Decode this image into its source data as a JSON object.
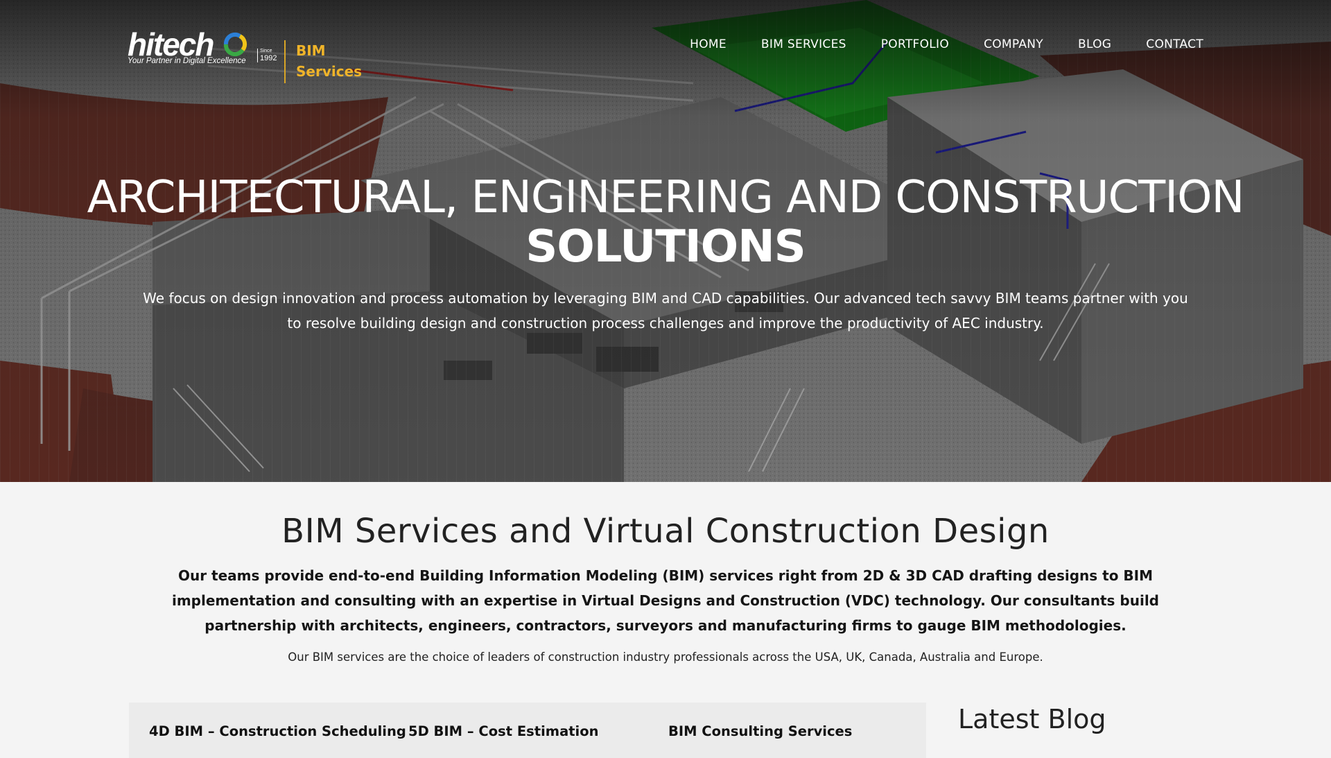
{
  "brand": {
    "logo_word": "hitech",
    "tagline": "Your Partner in Digital Excellence",
    "since_label": "Since",
    "since_year": "1992",
    "site_label": "BIM Services"
  },
  "nav": {
    "items": [
      "HOME",
      "BIM SERVICES",
      "PORTFOLIO",
      "COMPANY",
      "BLOG",
      "CONTACT"
    ]
  },
  "hero": {
    "title_line1": "ARCHITECTURAL, ENGINEERING AND CONSTRUCTION",
    "title_line2": "SOLUTIONS",
    "description": "We focus on design innovation and process automation by leveraging BIM and CAD capabilities. Our advanced tech savvy BIM teams partner with you to resolve building design and construction process challenges and improve the productivity of AEC industry."
  },
  "intro": {
    "title": "BIM Services and Virtual Construction Design",
    "lead": "Our teams provide end-to-end Building Information Modeling (BIM) services right from 2D & 3D CAD drafting designs to BIM implementation and consulting with an expertise in Virtual Designs and Construction (VDC) technology. Our consultants build partnership with architects, engineers, contractors, surveyors and manufacturing firms to gauge BIM methodologies.",
    "note": "Our BIM services are the choice of leaders of construction industry professionals across the USA, UK, Canada, Australia and Europe."
  },
  "services": {
    "items": [
      "4D BIM – Construction Scheduling",
      "5D BIM – Cost Estimation",
      "BIM Consulting Services"
    ]
  },
  "blog": {
    "title": "Latest Blog"
  },
  "colors": {
    "accent_gold": "#f0b429",
    "hero_text": "#ffffff",
    "body_bg": "#f4f4f4"
  }
}
